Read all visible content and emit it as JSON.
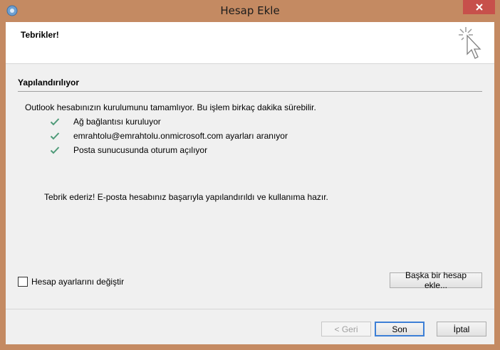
{
  "window": {
    "title": "Hesap Ekle"
  },
  "header": {
    "title": "Tebrikler!"
  },
  "section": {
    "title": "Yapılandırılıyor",
    "intro": "Outlook hesabınızın kurulumunu tamamlıyor. Bu işlem birkaç dakika sürebilir."
  },
  "steps": [
    {
      "label": "Ağ bağlantısı kuruluyor",
      "status_icon": "check-icon"
    },
    {
      "label": "emrahtolu@emrahtolu.onmicrosoft.com ayarları aranıyor",
      "status_icon": "check-icon"
    },
    {
      "label": "Posta sunucusunda oturum açılıyor",
      "status_icon": "check-icon"
    }
  ],
  "result": {
    "message": "Tebrik ederiz! E-posta hesabınız başarıyla yapılandırıldı ve kullanıma hazır."
  },
  "options": {
    "change_settings_label": "Hesap ayarlarını değiştir",
    "change_settings_checked": false
  },
  "buttons": {
    "add_another": "Başka bir hesap ekle...",
    "back": "< Geri",
    "finish": "Son",
    "cancel": "İptal"
  },
  "colors": {
    "frame": "#c48a62",
    "check": "#4e9a78",
    "focus": "#3c7fd6",
    "close": "#c7504b"
  }
}
